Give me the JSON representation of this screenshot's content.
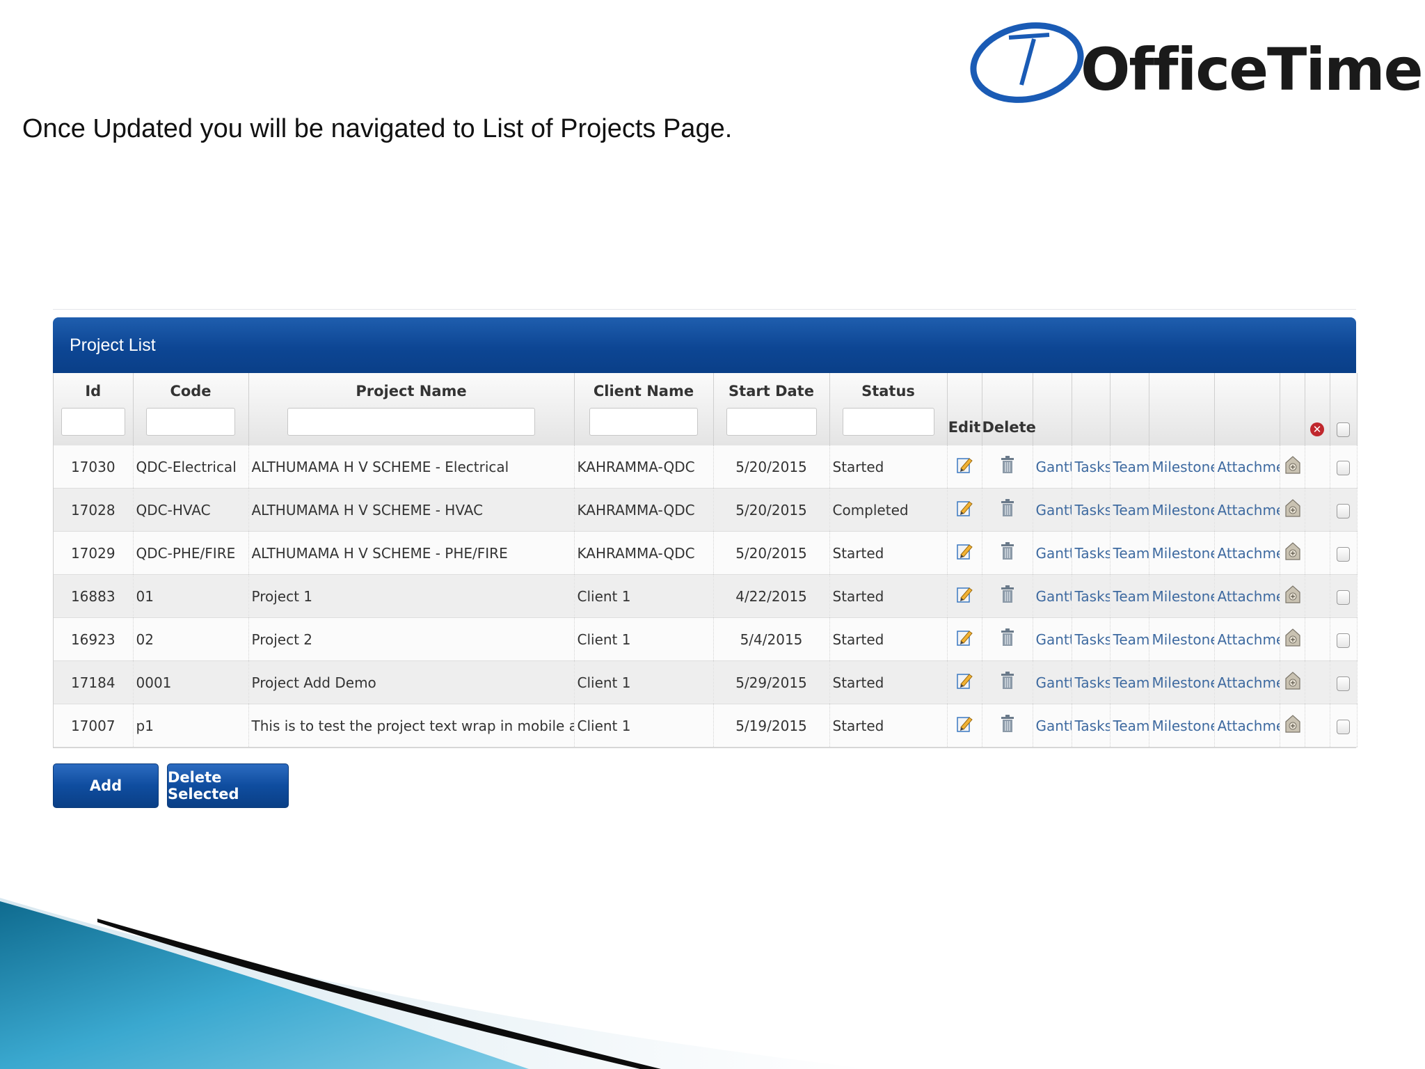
{
  "caption": "Once Updated you will be navigated to List of Projects Page.",
  "logo": {
    "text": "OfficeTimer",
    "brand_color": "#1a5bb5"
  },
  "panel": {
    "title": "Project List",
    "header_color": "#0d4694"
  },
  "columns": {
    "id": "Id",
    "code": "Code",
    "project_name": "Project Name",
    "client_name": "Client Name",
    "start_date": "Start Date",
    "status": "Status",
    "edit": "Edit",
    "delete": "Delete"
  },
  "rows": [
    {
      "id": "17030",
      "code": "QDC-Electrical",
      "project_name": "ALTHUMAMA H V SCHEME - Electrical",
      "client_name": "KAHRAMMA-QDC",
      "start_date": "5/20/2015",
      "status": "Started"
    },
    {
      "id": "17028",
      "code": "QDC-HVAC",
      "project_name": "ALTHUMAMA H V SCHEME - HVAC",
      "client_name": "KAHRAMMA-QDC",
      "start_date": "5/20/2015",
      "status": "Completed"
    },
    {
      "id": "17029",
      "code": "QDC-PHE/FIRE",
      "project_name": "ALTHUMAMA H V SCHEME - PHE/FIRE",
      "client_name": "KAHRAMMA-QDC",
      "start_date": "5/20/2015",
      "status": "Started"
    },
    {
      "id": "16883",
      "code": "01",
      "project_name": "Project 1",
      "client_name": "Client 1",
      "start_date": "4/22/2015",
      "status": "Started"
    },
    {
      "id": "16923",
      "code": "02",
      "project_name": "Project 2",
      "client_name": "Client 1",
      "start_date": "5/4/2015",
      "status": "Started"
    },
    {
      "id": "17184",
      "code": "0001",
      "project_name": "Project Add Demo",
      "client_name": "Client 1",
      "start_date": "5/29/2015",
      "status": "Started"
    },
    {
      "id": "17007",
      "code": "p1",
      "project_name": "This is to test the project text wrap in mobile ap",
      "client_name": "Client 1",
      "start_date": "5/19/2015",
      "status": "Started"
    }
  ],
  "row_links": {
    "gantt": "Gantt",
    "tasks": "Tasks",
    "team": "Team",
    "milestones": "Milestones",
    "attachment": "Attachment"
  },
  "icons": {
    "edit": "edit-pencil-icon",
    "delete": "trash-icon",
    "extra": "archive-icon",
    "clear": "clear-filter-icon"
  },
  "buttons": {
    "add": "Add",
    "delete_selected": "Delete Selected"
  }
}
